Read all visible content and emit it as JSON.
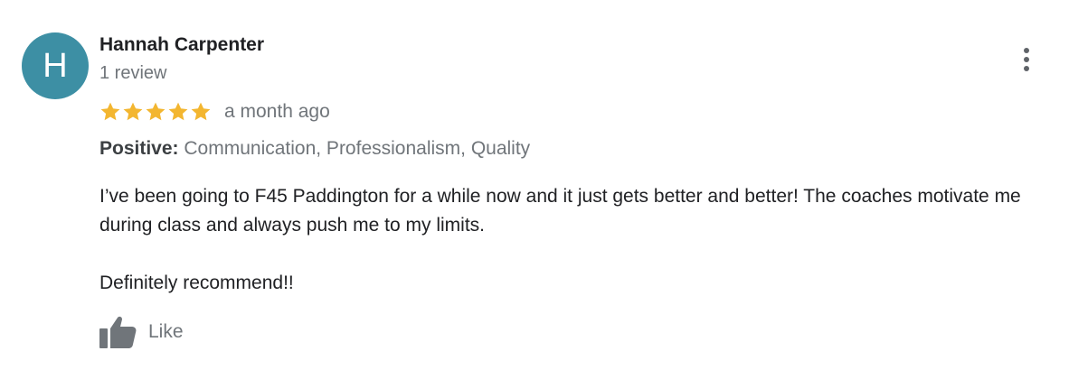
{
  "review": {
    "avatar_letter": "H",
    "author": "Hannah Carpenter",
    "review_count": "1 review",
    "rating": 5,
    "rating_max": 5,
    "time": "a month ago",
    "attributes_label": "Positive:",
    "attributes_values": "Communication, Professionalism, Quality",
    "text_paragraphs": [
      "I’ve been going to F45 Paddington for a while now and it just gets better and better! The coaches motivate me during class and always push me to my limits.",
      "Definitely recommend!!"
    ],
    "like_label": "Like",
    "icons": {
      "more": "more-vertical-icon",
      "star": "star-icon",
      "like": "thumbs-up-icon"
    }
  },
  "colors": {
    "avatar_bg": "#3d8fa4",
    "star": "#f3b630",
    "secondary_text": "#70757a",
    "primary_text": "#202124"
  }
}
